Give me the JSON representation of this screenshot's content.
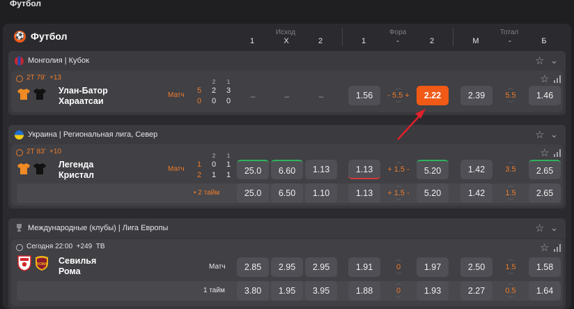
{
  "page_title": "Футбол",
  "sport": {
    "name": "Футбол"
  },
  "header": {
    "groups": {
      "outcome": "Исход",
      "handicap": "Фора",
      "total": "Тотал"
    },
    "cols": {
      "o1": "1",
      "ox": "X",
      "o2": "2",
      "h1": "1",
      "hm": "-",
      "h2": "2",
      "tm": "М",
      "tmid": "-",
      "tb": "Б"
    }
  },
  "leagues": [
    {
      "name": "Монголия | Кубок",
      "match": {
        "time": "2Т 79'",
        "extra": "+13",
        "team1": "Улан-Батор",
        "team2": "Хараатсаи",
        "label": "Матч",
        "score1": "5",
        "score2": "0",
        "p_head1": "2",
        "p_head2": "1",
        "p1": [
          "2",
          "3"
        ],
        "p2": [
          "0",
          "0"
        ],
        "o1": "–",
        "ox": "–",
        "o2": "–",
        "h1": "1.56",
        "hval": "- 5.5 +",
        "h2": "2.22",
        "tm": "2.39",
        "tval": "5.5",
        "tb": "1.46"
      }
    },
    {
      "name": "Украина | Региональная лига, Север",
      "match": {
        "time": "2Т 83'",
        "extra": "+10",
        "team1": "Легенда",
        "team2": "Кристал",
        "label": "Матч",
        "score1": "1",
        "score2": "2",
        "p_head1": "2",
        "p_head2": "1",
        "p1": [
          "0",
          "1"
        ],
        "p2": [
          "1",
          "1"
        ],
        "o1": "25.0",
        "ox": "6.60",
        "o2": "1.13",
        "h1": "1.13",
        "hval": "+ 1.5 -",
        "h2": "5.20",
        "tm": "1.42",
        "tval": "3.5",
        "tb": "2.65",
        "sub": {
          "label": "• 2 тайм",
          "o1": "25.0",
          "ox": "6.50",
          "o2": "1.10",
          "h1": "1.13",
          "hval": "+ 1.5 -",
          "h2": "5.20",
          "tm": "1.42",
          "tval": "1.5",
          "tb": "2.65"
        }
      }
    },
    {
      "name": "Международные (клубы) | Лига Европы",
      "match": {
        "time": "Сегодня 22:00",
        "extra": "+249",
        "tv": "ТВ",
        "team1": "Севилья",
        "team2": "Рома",
        "label": "Матч",
        "o1": "2.85",
        "ox": "2.95",
        "o2": "2.95",
        "h1": "1.91",
        "hval": "0",
        "h2": "1.97",
        "tm": "2.50",
        "tval": "1.5",
        "tb": "1.58",
        "sub": {
          "label": "1 тайм",
          "o1": "3.80",
          "ox": "1.95",
          "o2": "3.95",
          "h1": "1.88",
          "hval": "0",
          "h2": "1.93",
          "tm": "2.27",
          "tval": "0.5",
          "tb": "1.64"
        }
      }
    }
  ],
  "colors": {
    "accent": "#f05a16",
    "up": "#2fb45a",
    "down": "#d23c3c",
    "annotation": "#e0202a"
  }
}
